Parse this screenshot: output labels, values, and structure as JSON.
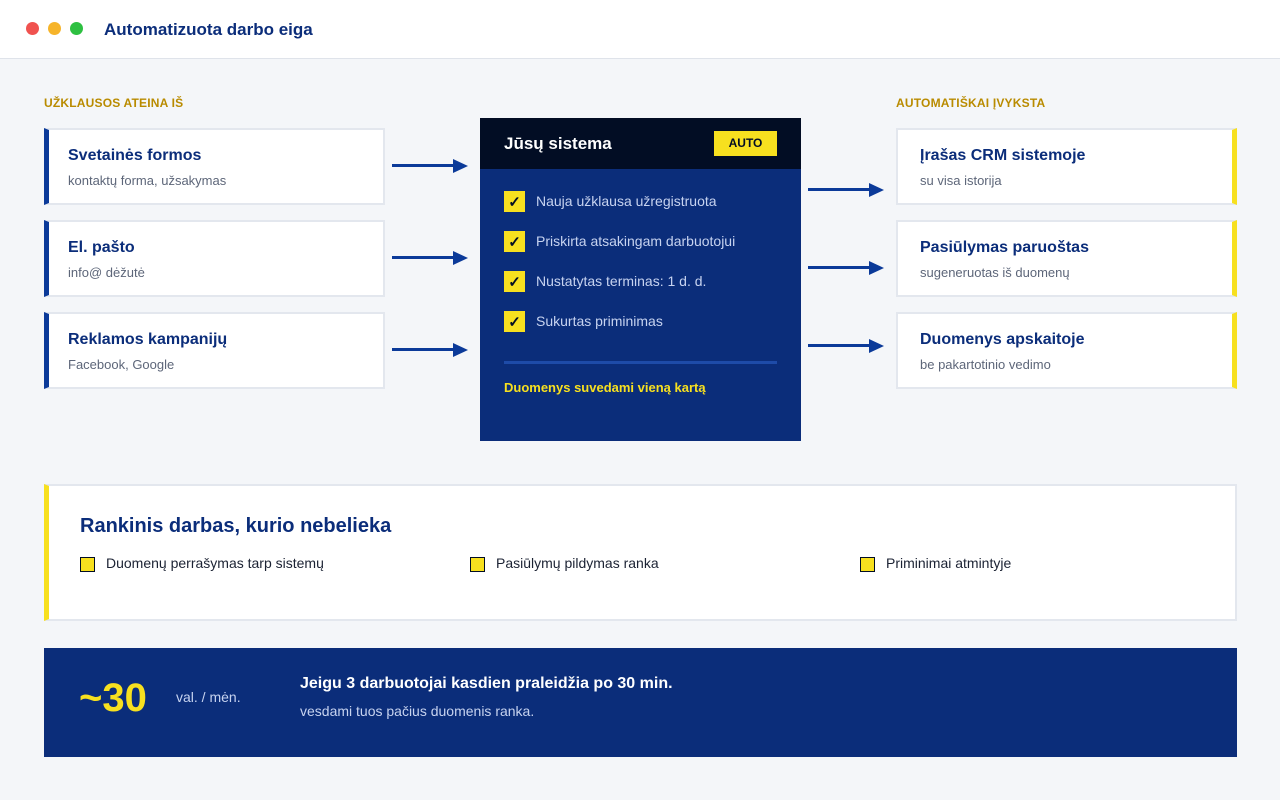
{
  "window": {
    "title": "Automatizuota darbo eiga"
  },
  "colors": {
    "primary": "#0b2d7a",
    "accent": "#f7e01f",
    "dark": "#020d24",
    "label_gold": "#b98b00"
  },
  "inputs": {
    "label": "UŽKLAUSOS ATEINA IŠ",
    "items": [
      {
        "title": "Svetainės formos",
        "subtitle": "kontaktų forma, užsakymas"
      },
      {
        "title": "El. pašto",
        "subtitle": "info@ dėžutė"
      },
      {
        "title": "Reklamos kampanijų",
        "subtitle": "Facebook, Google"
      }
    ]
  },
  "system": {
    "title": "Jūsų sistema",
    "badge": "AUTO",
    "check_icon": "✓",
    "steps": [
      "Nauja užklausa užregistruota",
      "Priskirta atsakingam darbuotojui",
      "Nustatytas terminas: 1 d. d.",
      "Sukurtas priminimas"
    ],
    "footer": "Duomenys suvedami vieną kartą"
  },
  "outputs": {
    "label": "AUTOMATIŠKAI ĮVYKSTA",
    "items": [
      {
        "title": "Įrašas CRM sistemoje",
        "subtitle": "su visa istorija"
      },
      {
        "title": "Pasiūlymas paruoštas",
        "subtitle": "sugeneruotas iš duomenų"
      },
      {
        "title": "Duomenys apskaitoje",
        "subtitle": "be pakartotinio vedimo"
      }
    ]
  },
  "manual": {
    "title": "Rankinis darbas, kurio nebelieka",
    "items": [
      "Duomenų perrašymas tarp sistemų",
      "Pasiūlymų pildymas ranka",
      "Priminimai atmintyje"
    ]
  },
  "stats": {
    "value": "~30",
    "unit": "val. / mėn.",
    "headline": "Jeigu 3 darbuotojai kasdien praleidžia po 30 min.",
    "subline": "vesdami tuos pačius duomenis ranka."
  }
}
